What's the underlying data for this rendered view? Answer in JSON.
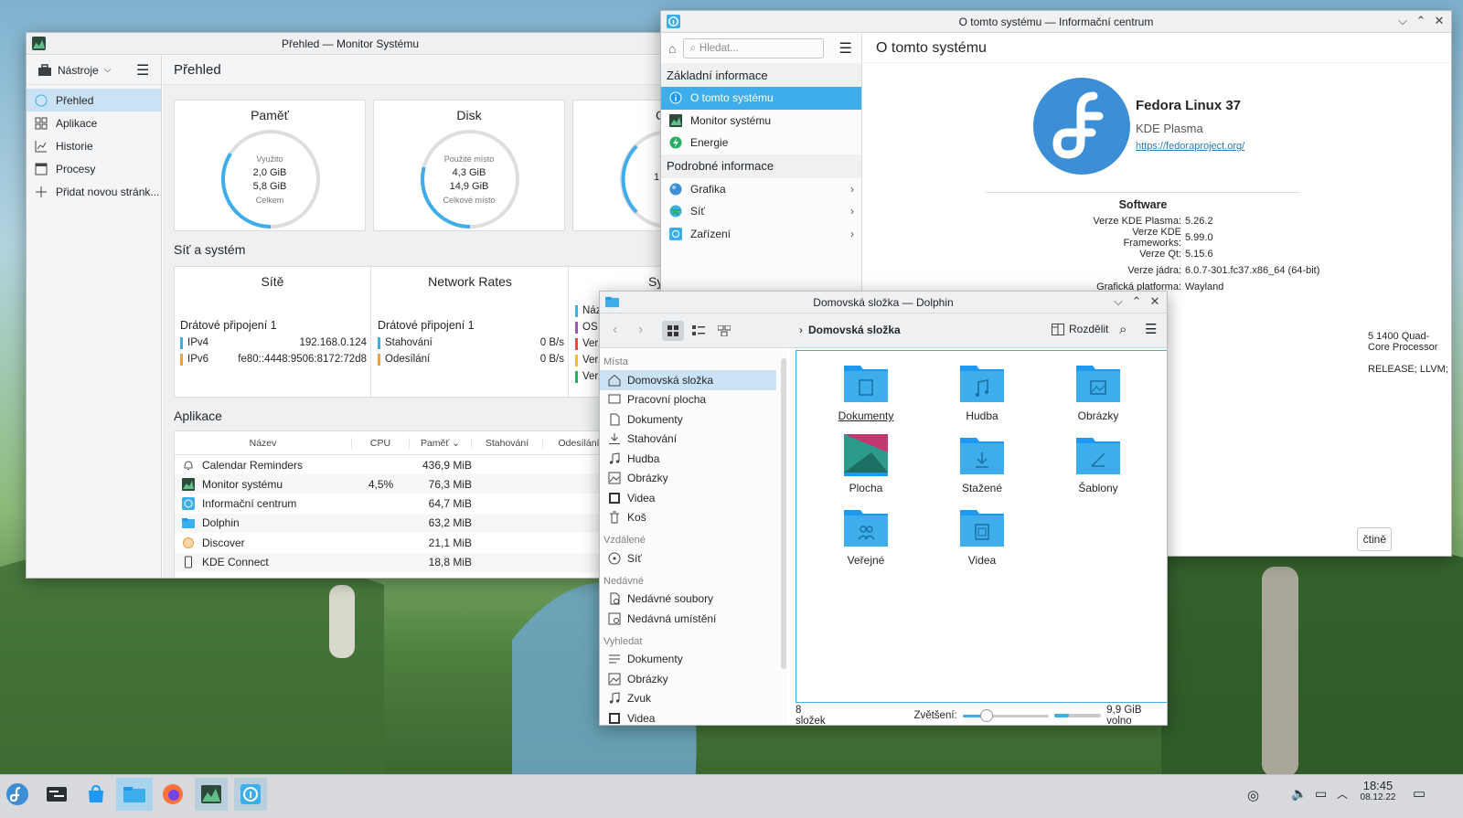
{
  "colors": {
    "accent": "#3daee9",
    "selection": "#cbe2f4",
    "panel": "#d7d9dc",
    "fedora": "#3c8fd6",
    "link": "#2980b9"
  },
  "sysmon": {
    "title": "Přehled — Monitor Systému",
    "tools_label": "Nástroje",
    "page_title": "Přehled",
    "nav": [
      {
        "label": "Přehled",
        "icon": "overview-icon"
      },
      {
        "label": "Aplikace",
        "icon": "grid-icon"
      },
      {
        "label": "Historie",
        "icon": "chart-icon"
      },
      {
        "label": "Procesy",
        "icon": "window-icon"
      },
      {
        "label": "Přidat novou stránk...",
        "icon": "plus-icon"
      }
    ],
    "memory": {
      "title": "Paměť",
      "used_label": "Využito",
      "used": "2,0 GiB",
      "total": "5,8 GiB",
      "total_label": "Celkem",
      "fraction": 0.34
    },
    "disk": {
      "title": "Disk",
      "used_label": "Použité místo",
      "used": "4,3 GiB",
      "total": "14,9 GiB",
      "total_label": "Celkové místo",
      "fraction": 0.29
    },
    "cpu_card_partial": "C",
    "cpu_partial_value": "1.",
    "net_section": "Síť a systém",
    "networks": {
      "title": "Sítě",
      "conn": "Drátové připojení 1",
      "ipv4_label": "IPv4",
      "ipv4": "192.168.0.124",
      "ipv6_label": "IPv6",
      "ipv6": "fe80::4448:9506:8172:72d8"
    },
    "rates": {
      "title": "Network Rates",
      "conn": "Drátové připojení 1",
      "down_label": "Stahování",
      "down": "0 B/s",
      "up_label": "Odesílání",
      "up": "0 B/s"
    },
    "sys_partial": {
      "title": "Sys",
      "r1": "Náze",
      "r2": "OS",
      "r3": "Verz",
      "r4": "Verz",
      "r5": "Verz"
    },
    "apps_section": "Aplikace",
    "apps_headers": {
      "name": "Název",
      "cpu": "CPU",
      "mem": "Paměť",
      "down": "Stahování",
      "up": "Odesílání"
    },
    "apps": [
      {
        "name": "Calendar Reminders",
        "cpu": "",
        "mem": "436,9 MiB",
        "icon": "bell-icon"
      },
      {
        "name": "Monitor systému",
        "cpu": "4,5%",
        "mem": "76,3 MiB",
        "icon": "sysmon-icon"
      },
      {
        "name": "Informační centrum",
        "cpu": "",
        "mem": "64,7 MiB",
        "icon": "info-center-icon"
      },
      {
        "name": "Dolphin",
        "cpu": "",
        "mem": "63,2 MiB",
        "icon": "dolphin-icon"
      },
      {
        "name": "Discover",
        "cpu": "",
        "mem": "21,1 MiB",
        "icon": "discover-icon"
      },
      {
        "name": "KDE Connect",
        "cpu": "",
        "mem": "18,8 MiB",
        "icon": "phone-icon"
      }
    ]
  },
  "info": {
    "title": "O tomto systému — Informační centrum",
    "search_placeholder": "Hledat...",
    "page_title": "O tomto systému",
    "basic_section": "Základní informace",
    "basic": [
      {
        "label": "O tomto systému",
        "icon": "info-icon"
      },
      {
        "label": "Monitor systému",
        "icon": "sysmon-icon"
      },
      {
        "label": "Energie",
        "icon": "energy-icon"
      }
    ],
    "detail_section": "Podrobné informace",
    "detail": [
      {
        "label": "Grafika",
        "icon": "graphics-icon"
      },
      {
        "label": "Síť",
        "icon": "network-globe-icon"
      },
      {
        "label": "Zařízení",
        "icon": "devices-icon"
      }
    ],
    "distro": "Fedora Linux 37",
    "desktop": "KDE Plasma",
    "url": "https://fedoraproject.org/",
    "software_title": "Software",
    "software": [
      {
        "k": "Verze KDE Plasma:",
        "v": "5.26.2"
      },
      {
        "k": "Verze KDE Frameworks:",
        "v": "5.99.0"
      },
      {
        "k": "Verze Qt:",
        "v": "5.15.6"
      },
      {
        "k": "Verze jádra:",
        "v": "6.0.7-301.fc37.x86_64 (64-bit)"
      },
      {
        "k": "Grafická platforma:",
        "v": "Wayland"
      }
    ],
    "hw_partial1": "5 1400 Quad-Core Processor",
    "hw_partial2": "RELEASE; LLVM;",
    "button_partial": "čtině"
  },
  "dolphin": {
    "title": "Domovská složka — Dolphin",
    "breadcrumb": "Domovská složka",
    "split_label": "Rozdělit",
    "places_section": "Místa",
    "places": [
      {
        "label": "Domovská složka",
        "icon": "home-icon",
        "sel": true
      },
      {
        "label": "Pracovní plocha",
        "icon": "desktop-icon"
      },
      {
        "label": "Dokumenty",
        "icon": "document-icon"
      },
      {
        "label": "Stahování",
        "icon": "download-icon"
      },
      {
        "label": "Hudba",
        "icon": "music-icon"
      },
      {
        "label": "Obrázky",
        "icon": "image-icon"
      },
      {
        "label": "Videa",
        "icon": "video-icon"
      },
      {
        "label": "Koš",
        "icon": "trash-icon"
      }
    ],
    "remote_section": "Vzdálené",
    "remote": [
      {
        "label": "Síť",
        "icon": "network-icon"
      }
    ],
    "recent_section": "Nedávné",
    "recent": [
      {
        "label": "Nedávné soubory",
        "icon": "recent-files-icon"
      },
      {
        "label": "Nedávná umístění",
        "icon": "recent-places-icon"
      }
    ],
    "search_section": "Vyhledat",
    "search": [
      {
        "label": "Dokumenty",
        "icon": "document-search-icon"
      },
      {
        "label": "Obrázky",
        "icon": "image-icon"
      },
      {
        "label": "Zvuk",
        "icon": "music-icon"
      },
      {
        "label": "Videa",
        "icon": "video-icon"
      }
    ],
    "folders": [
      {
        "label": "Dokumenty",
        "icon": "folder-documents-icon"
      },
      {
        "label": "Hudba",
        "icon": "folder-music-icon"
      },
      {
        "label": "Obrázky",
        "icon": "folder-pictures-icon"
      },
      {
        "label": "Plocha",
        "icon": "folder-desktop-icon"
      },
      {
        "label": "Stažené",
        "icon": "folder-download-icon"
      },
      {
        "label": "Šablony",
        "icon": "folder-templates-icon"
      },
      {
        "label": "Veřejné",
        "icon": "folder-public-icon"
      },
      {
        "label": "Videa",
        "icon": "folder-videos-icon"
      }
    ],
    "status_count": "8 složek",
    "zoom_label": "Zvětšení:",
    "zoom_level": 0.28,
    "disk_used_fraction": 0.3,
    "free_space": "9,9 GiB volno"
  },
  "taskbar": {
    "time": "18:45",
    "date": "08.12.22",
    "apps": [
      "fedora-launcher-icon",
      "pager-icon",
      "discover-icon",
      "dolphin-icon",
      "firefox-icon",
      "sysmon-icon",
      "info-center-icon"
    ]
  }
}
